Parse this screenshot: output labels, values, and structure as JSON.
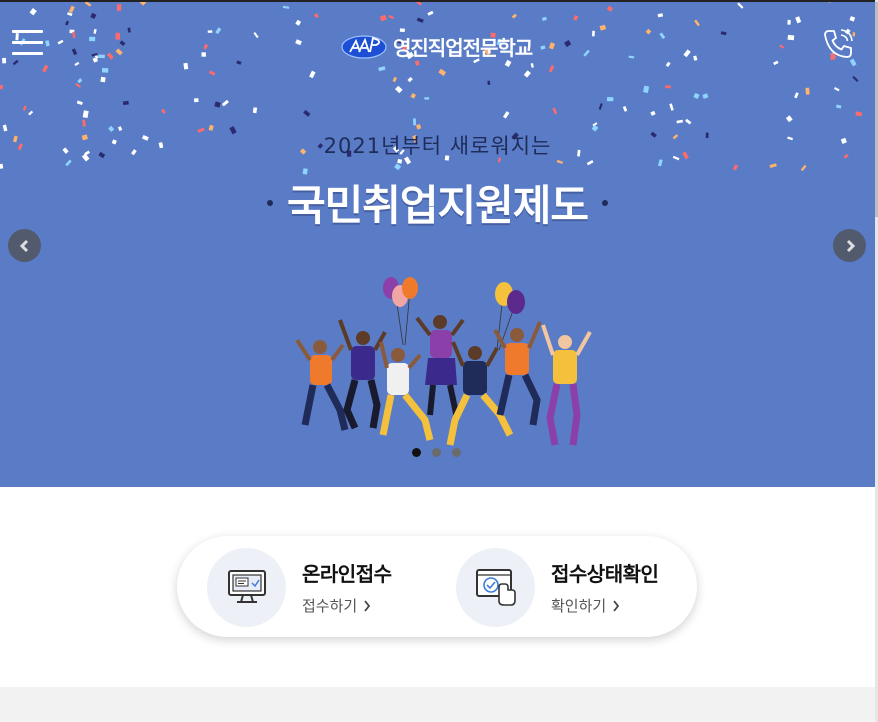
{
  "header": {
    "logo_text": "영진직업전문학교",
    "menu_icon": "hamburger-icon",
    "phone_icon": "phone-icon"
  },
  "banner": {
    "subtitle": "2021년부터 새로워지는",
    "title": "국민취업지원제도",
    "background_color": "#5a7cc6",
    "prev_icon": "chevron-left-icon",
    "next_icon": "chevron-right-icon",
    "slide_count": 3,
    "active_slide": 1
  },
  "quick_actions": [
    {
      "title": "온라인접수",
      "link": "접수하기",
      "icon": "computer-monitor-icon"
    },
    {
      "title": "접수상태확인",
      "link": "확인하기",
      "icon": "check-click-icon"
    }
  ]
}
